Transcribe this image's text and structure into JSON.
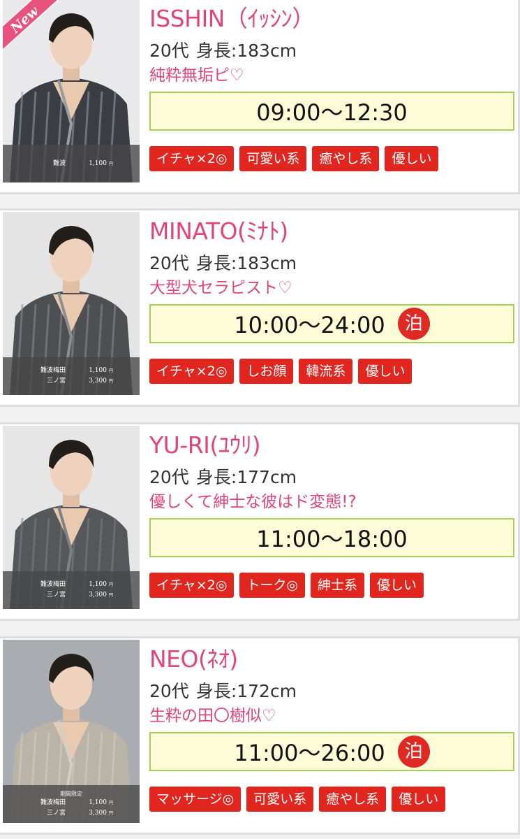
{
  "cast": [
    {
      "name": "ISSHIN（ｲｯｼﾝ）",
      "age": "20代",
      "height": "身長:183cm",
      "catch": "純粋無垢ピ♡",
      "hours": "09:00〜12:30",
      "overnight": "",
      "new_badge": "New",
      "price_note": "",
      "prices": [
        {
          "area": "難波",
          "fee": "1,100",
          "unit": "円"
        }
      ],
      "tags": [
        "イチャ×2◎",
        "可愛い系",
        "癒やし系",
        "優しい"
      ],
      "colors": {
        "bg": "#e9e9ec",
        "robe": "#3b3d44",
        "stripe": "#9a9ca4"
      }
    },
    {
      "name": "MINATO(ﾐﾅﾄ)",
      "age": "20代",
      "height": "身長:183cm",
      "catch": "大型犬セラピスト♡",
      "hours": "10:00〜24:00",
      "overnight": "泊",
      "new_badge": "",
      "price_note": "",
      "prices": [
        {
          "area": "難波梅田",
          "fee": "1,100",
          "unit": "円"
        },
        {
          "area": "三ノ宮",
          "fee": "3,300",
          "unit": "円"
        }
      ],
      "tags": [
        "イチャ×2◎",
        "しお顔",
        "韓流系",
        "優しい"
      ],
      "colors": {
        "bg": "#e4e4e4",
        "robe": "#4e4f52",
        "stripe": "#8d8e92"
      }
    },
    {
      "name": "YU-RI(ﾕｳﾘ)",
      "age": "20代",
      "height": "身長:177cm",
      "catch": "優しくて紳士な彼はド変態!?",
      "hours": "11:00〜18:00",
      "overnight": "",
      "new_badge": "",
      "price_note": "",
      "prices": [
        {
          "area": "難波梅田",
          "fee": "1,100",
          "unit": "円"
        },
        {
          "area": "三ノ宮",
          "fee": "3,300",
          "unit": "円"
        }
      ],
      "tags": [
        "イチャ×2◎",
        "トーク◎",
        "紳士系",
        "優しい"
      ],
      "colors": {
        "bg": "#e6e6e6",
        "robe": "#55575a",
        "stripe": "#7e8084"
      }
    },
    {
      "name": "NEO(ﾈｵ)",
      "age": "20代",
      "height": "身長:172cm",
      "catch": "生粋の田〇樹似♡",
      "hours": "11:00〜26:00",
      "overnight": "泊",
      "new_badge": "",
      "price_note": "期間限定",
      "prices": [
        {
          "area": "難波梅田",
          "fee": "1,100",
          "unit": "円"
        },
        {
          "area": "三ノ宮",
          "fee": "3,300",
          "unit": "円"
        }
      ],
      "tags": [
        "マッサージ◎",
        "可愛い系",
        "癒やし系",
        "優しい"
      ],
      "colors": {
        "bg": "#a9acb1",
        "robe": "#b9b3a8",
        "stripe": "#d4cec4"
      }
    }
  ]
}
